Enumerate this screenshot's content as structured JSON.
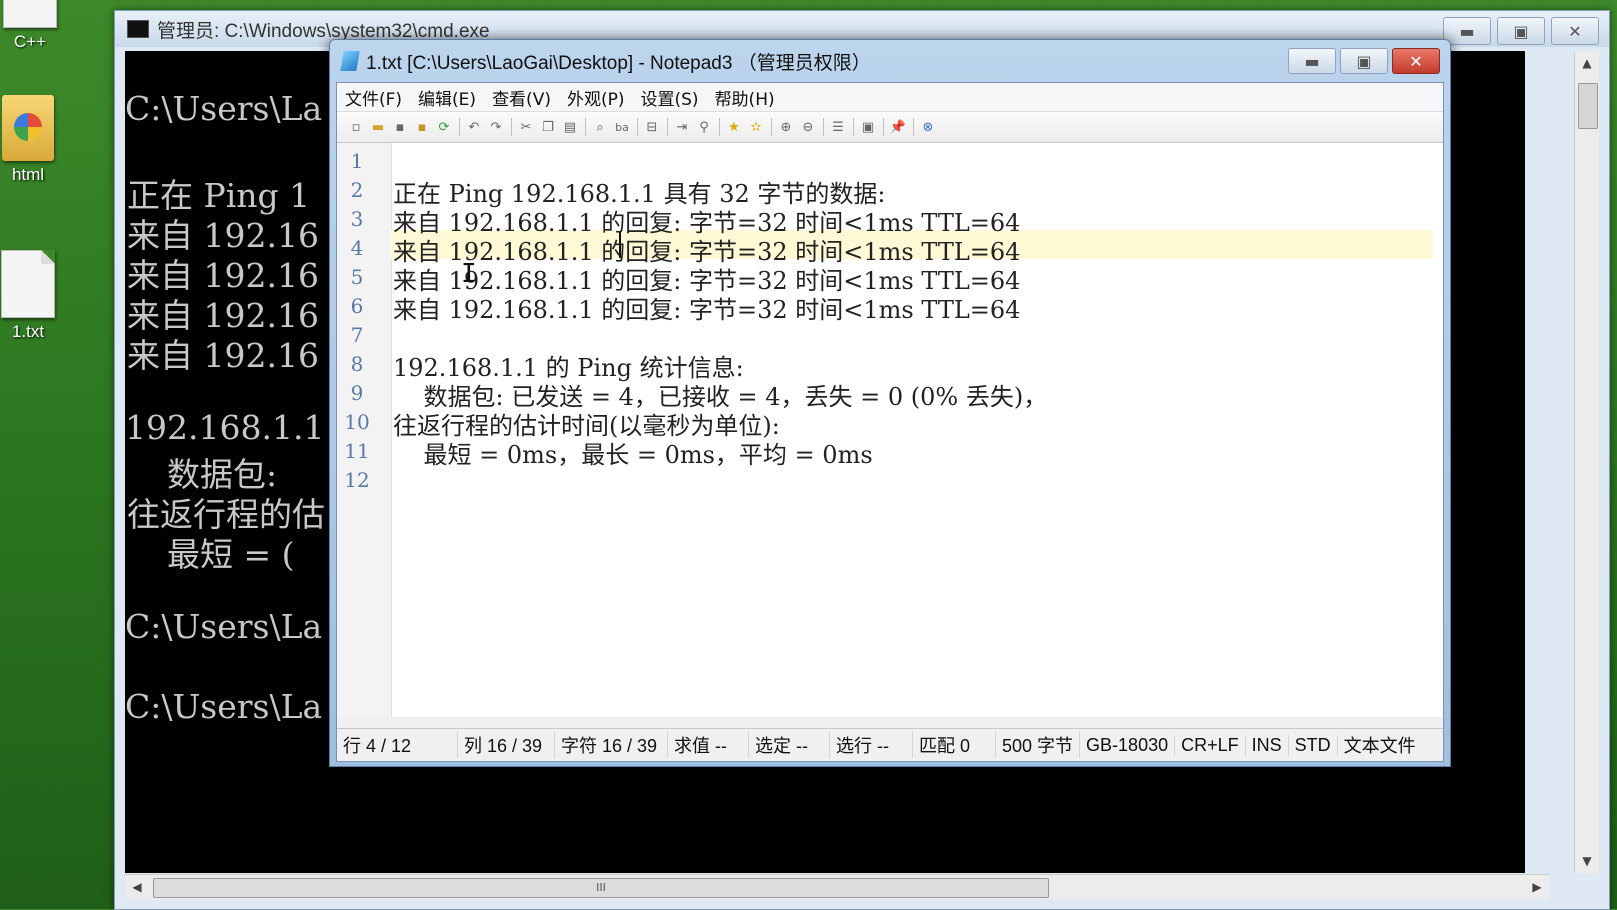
{
  "desktop": {
    "icons": [
      {
        "label": "C++"
      },
      {
        "label": "html"
      },
      {
        "label": "1.txt"
      }
    ]
  },
  "cmd": {
    "title": "管理员: C:\\Windows\\system32\\cmd.exe",
    "lines": [
      "C:\\Users\\La",
      "正在 Ping 1",
      "来自 192.16",
      "来自 192.16",
      "来自 192.16",
      "来自 192.16",
      "192.168.1.1",
      "    数据包:",
      "往返行程的估",
      "    最短 = (",
      "C:\\Users\\La",
      "C:\\Users\\La"
    ],
    "scroll_h_thumb": "III"
  },
  "notepad": {
    "title": "1.txt [C:\\Users\\LaoGai\\Desktop] - Notepad3 （管理员权限）",
    "menu": [
      "文件(F)",
      "编辑(E)",
      "查看(V)",
      "外观(P)",
      "设置(S)",
      "帮助(H)"
    ],
    "lines": [
      {
        "num": "1",
        "text": ""
      },
      {
        "num": "2",
        "text": "正在 Ping 192.168.1.1 具有 32 字节的数据:"
      },
      {
        "num": "3",
        "text": "来自 192.168.1.1 的回复: 字节=32 时间<1ms TTL=64"
      },
      {
        "num": "4",
        "text": "来自 192.168.1.1 的回复: 字节=32 时间<1ms TTL=64"
      },
      {
        "num": "5",
        "text": "来自 192.168.1.1 的回复: 字节=32 时间<1ms TTL=64"
      },
      {
        "num": "6",
        "text": "来自 192.168.1.1 的回复: 字节=32 时间<1ms TTL=64"
      },
      {
        "num": "7",
        "text": ""
      },
      {
        "num": "8",
        "text": "192.168.1.1 的 Ping 统计信息:"
      },
      {
        "num": "9",
        "text": "    数据包: 已发送 = 4，已接收 = 4，丢失 = 0 (0% 丢失)，"
      },
      {
        "num": "10",
        "text": "往返行程的估计时间(以毫秒为单位):"
      },
      {
        "num": "11",
        "text": "    最短 = 0ms，最长 = 0ms，平均 = 0ms"
      },
      {
        "num": "12",
        "text": ""
      }
    ],
    "current_line": 4,
    "status": [
      "行 4 / 12",
      "列 16 / 39",
      "字符 16 / 39",
      "求值 --",
      "选定 --",
      "选行 --",
      "匹配 0",
      "500 字节",
      "GB-18030",
      "CR+LF",
      "INS",
      "STD",
      "文本文件"
    ]
  }
}
